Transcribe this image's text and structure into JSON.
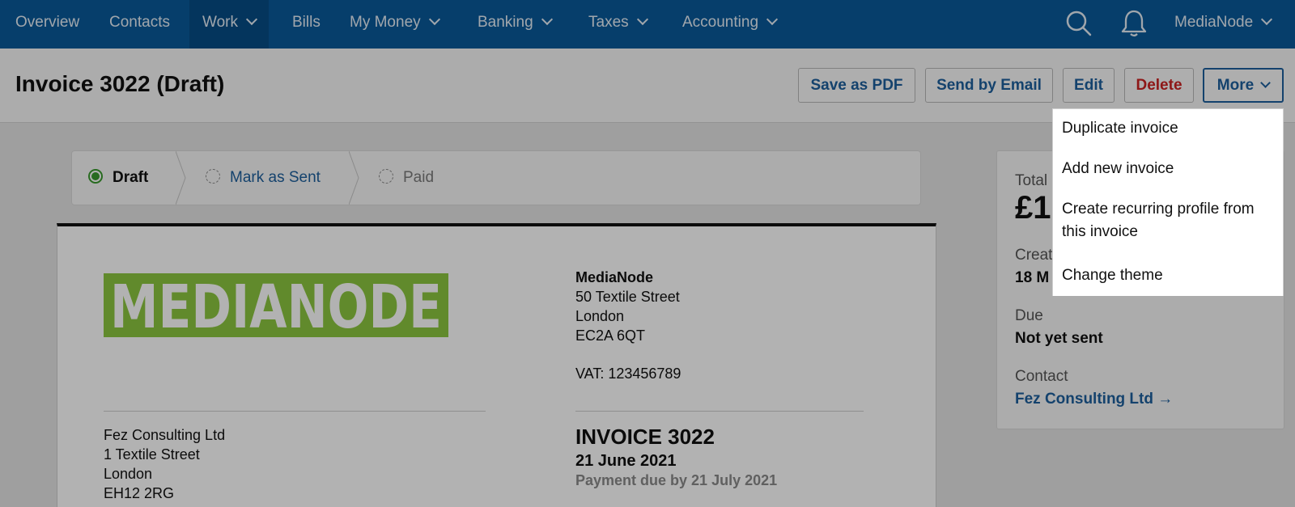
{
  "nav": {
    "items": [
      {
        "label": "Overview"
      },
      {
        "label": "Contacts"
      },
      {
        "label": "Work"
      },
      {
        "label": "Bills"
      },
      {
        "label": "My Money"
      },
      {
        "label": "Banking"
      },
      {
        "label": "Taxes"
      },
      {
        "label": "Accounting"
      }
    ],
    "active": "Work",
    "account_label": "MediaNode"
  },
  "header": {
    "title": "Invoice 3022 (Draft)",
    "save_pdf_label": "Save as PDF",
    "send_email_label": "Send by Email",
    "edit_label": "Edit",
    "delete_label": "Delete",
    "more_label": "More"
  },
  "steps": [
    {
      "label": "Draft",
      "state": "current"
    },
    {
      "label": "Mark as Sent",
      "state": "action"
    },
    {
      "label": "Paid",
      "state": "pending"
    }
  ],
  "invoice": {
    "logo_text": "MEDIANODE",
    "from": {
      "name": "MediaNode",
      "street": "50 Textile Street",
      "city": "London",
      "postcode": "EC2A 6QT",
      "vat": "VAT: 123456789"
    },
    "to": {
      "name": "Fez Consulting Ltd",
      "street": "1 Textile Street",
      "city": "London",
      "postcode": "EH12 2RG"
    },
    "number_title": "INVOICE 3022",
    "date": "21 June 2021",
    "payment_due": "Payment due by 21 July 2021"
  },
  "summary": {
    "total_label": "Total",
    "total_value_partial": "£1",
    "created_label": "Creat",
    "created_value_partial": "18 M",
    "due_label": "Due",
    "due_value": "Not yet sent",
    "contact_label": "Contact",
    "contact_link": "Fez Consulting Ltd →"
  },
  "more_menu": {
    "items": [
      {
        "label": "Duplicate invoice"
      },
      {
        "label": "Add new invoice"
      },
      {
        "label": "Create recurring profile from this invoice"
      },
      {
        "label": "Change theme"
      }
    ],
    "highlighted": "Change theme"
  },
  "colors": {
    "nav_bg": "#0a5a9a",
    "link_blue": "#1d5f9c",
    "delete_red": "#cc2222",
    "logo_green": "#8cc63f",
    "draft_green": "#3a9a2e"
  }
}
